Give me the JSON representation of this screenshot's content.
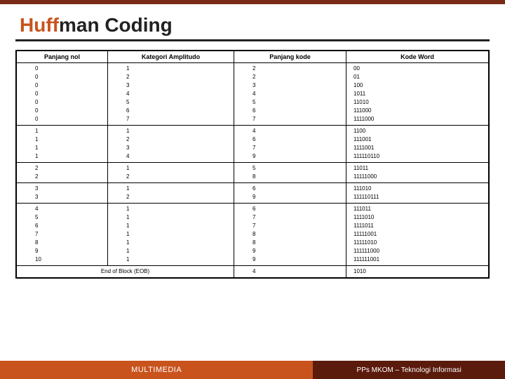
{
  "title": {
    "accent": "Huff",
    "rest": "man Coding"
  },
  "headers": [
    "Panjang nol",
    "Kategori Amplitudo",
    "Panjang kode",
    "Kode Word"
  ],
  "groups": [
    {
      "rows": [
        [
          "0",
          "1",
          "2",
          "00"
        ],
        [
          "0",
          "2",
          "2",
          "01"
        ],
        [
          "0",
          "3",
          "3",
          "100"
        ],
        [
          "0",
          "4",
          "4",
          "1011"
        ],
        [
          "0",
          "5",
          "5",
          "11010"
        ],
        [
          "0",
          "6",
          "6",
          "111000"
        ],
        [
          "0",
          "7",
          "7",
          "1111000"
        ]
      ]
    },
    {
      "rows": [
        [
          "1",
          "1",
          "4",
          "1100"
        ],
        [
          "1",
          "2",
          "6",
          "111001"
        ],
        [
          "1",
          "3",
          "7",
          "1111001"
        ],
        [
          "1",
          "4",
          "9",
          "111110110"
        ]
      ]
    },
    {
      "rows": [
        [
          "2",
          "1",
          "5",
          "11011"
        ],
        [
          "2",
          "2",
          "8",
          "11111000"
        ]
      ]
    },
    {
      "rows": [
        [
          "3",
          "1",
          "6",
          "111010"
        ],
        [
          "3",
          "2",
          "9",
          "111110111"
        ]
      ]
    },
    {
      "rows": [
        [
          "4",
          "1",
          "6",
          "111011"
        ],
        [
          "5",
          "1",
          "7",
          "1111010"
        ],
        [
          "6",
          "1",
          "7",
          "1111011"
        ],
        [
          "7",
          "1",
          "8",
          "11111001"
        ],
        [
          "8",
          "1",
          "8",
          "11111010"
        ],
        [
          "9",
          "1",
          "9",
          "111111000"
        ],
        [
          "10",
          "1",
          "9",
          "111111001"
        ]
      ]
    },
    {
      "eob": "End of Block (EOB)",
      "rows": [
        [
          "",
          "",
          "4",
          "1010"
        ]
      ]
    }
  ],
  "footer": {
    "left": "MULTIMEDIA",
    "right": "PPs MKOM – Teknologi Informasi"
  }
}
